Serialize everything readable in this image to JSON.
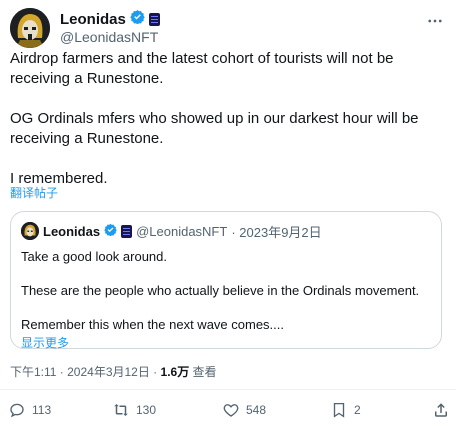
{
  "author": {
    "name": "Leonidas",
    "handle": "@LeonidasNFT"
  },
  "tweet": {
    "line1": "Airdrop farmers and the latest cohort of tourists will not be receiving a Runestone.",
    "line2": "OG Ordinals mfers who showed up in our darkest hour will be receiving a Runestone.",
    "line3": "I remembered.",
    "translate": "翻译帖子"
  },
  "quote": {
    "name": "Leonidas",
    "handle": "@LeonidasNFT",
    "date": "· 2023年9月2日",
    "line1": "Take a good look around.",
    "line2": "These are the people who actually believe in the Ordinals movement.",
    "line3": "Remember this when the next wave comes....",
    "show_more": "显示更多"
  },
  "meta": {
    "time": "下午1:11 · 2024年3月12日 · ",
    "views": "1.6万",
    "views_label": " 查看"
  },
  "actions": {
    "replies": "113",
    "reposts": "130",
    "likes": "548",
    "bookmarks": "2"
  },
  "colors": {
    "verified": "#1d9bf0",
    "link": "#1d9bf0",
    "muted": "#536471"
  },
  "icons": [
    "more-icon",
    "verified-icon",
    "ordinals-badge-icon",
    "reply-icon",
    "repost-icon",
    "like-icon",
    "bookmark-icon",
    "share-icon"
  ]
}
